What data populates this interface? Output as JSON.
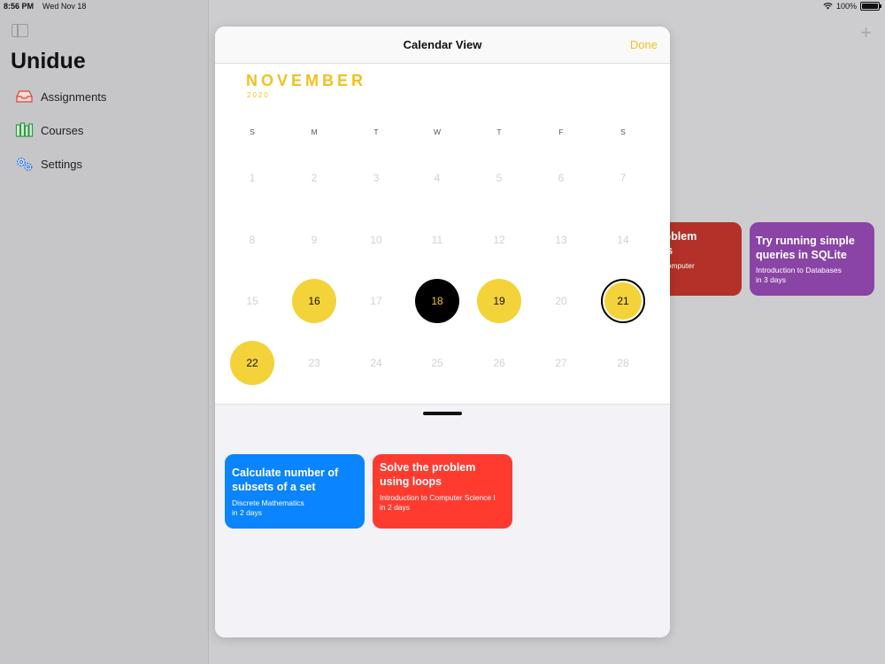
{
  "status": {
    "time": "8:56 PM",
    "date": "Wed Nov 18",
    "battery": "100%"
  },
  "app": {
    "title": "Unidue",
    "nav": [
      {
        "label": "Assignments",
        "icon": "tray-icon"
      },
      {
        "label": "Courses",
        "icon": "books-icon"
      },
      {
        "label": "Settings",
        "icon": "gears-icon"
      }
    ]
  },
  "background_cards": [
    {
      "title": "problem\nops",
      "course": "to Computer",
      "due": "",
      "color": "#b33128"
    },
    {
      "title": "Try running simple queries in SQLite",
      "course": "Introduction to Databases",
      "due": "in 3 days",
      "color": "#8a44a6"
    }
  ],
  "modal": {
    "title": "Calendar View",
    "done_label": "Done",
    "month": "NOVEMBER",
    "year": "2020",
    "weekdays": [
      "S",
      "M",
      "T",
      "W",
      "T",
      "F",
      "S"
    ],
    "days": [
      "1",
      "2",
      "3",
      "4",
      "5",
      "6",
      "7",
      "8",
      "9",
      "10",
      "11",
      "12",
      "13",
      "14",
      "15",
      "16",
      "17",
      "18",
      "19",
      "20",
      "21",
      "22",
      "23",
      "24",
      "25",
      "26",
      "27",
      "28"
    ],
    "accent_color": "#f4d33a"
  },
  "assignments": [
    {
      "title": "Calculate number of subsets of a set",
      "course": "Discrete Mathematics",
      "due": "in 2 days",
      "color": "#0a84ff"
    },
    {
      "title": "Solve the problem using loops",
      "course": "Introduction to Computer Science I",
      "due": "in 2 days",
      "color": "#ff3b30"
    }
  ]
}
